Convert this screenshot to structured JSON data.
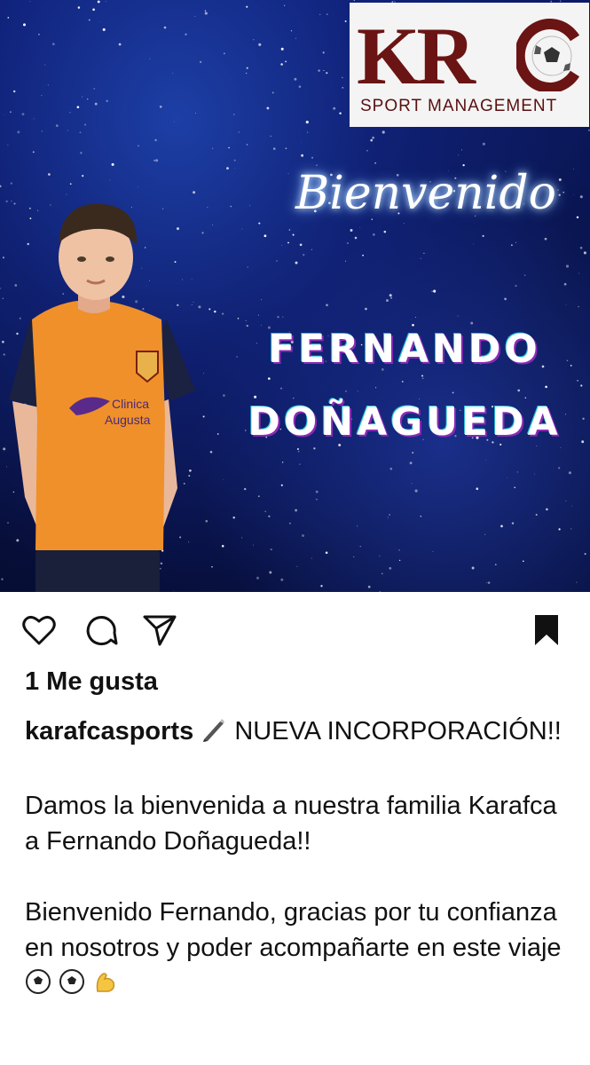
{
  "post": {
    "logo": {
      "letters": "KR",
      "ball_letter": "C",
      "subtitle": "SPORT MANAGEMENT"
    },
    "graphic_text": {
      "greeting": "Bienvenido",
      "first_name": "FERNANDO",
      "last_name": "DOÑAGUEDA"
    },
    "jersey_sponsor": "Clinica Augusta",
    "colors": {
      "brand": "#6b1414",
      "jersey": "#f0902a",
      "night_sky": "#0b1a66"
    }
  },
  "actions": {
    "like_icon": "heart-icon",
    "comment_icon": "comment-icon",
    "share_icon": "send-icon",
    "save_icon": "bookmark-icon"
  },
  "likes_text": "1 Me gusta",
  "caption": {
    "username": "karafcasports",
    "headline": "NUEVA INCORPORACIÓN!!",
    "paragraph1": "Damos la bienvenida a nuestra familia Karafca a Fernando Doñagueda!!",
    "paragraph2": "Bienvenido Fernando, gracias por tu confianza en nosotros y poder acompañarte en este viaje"
  }
}
